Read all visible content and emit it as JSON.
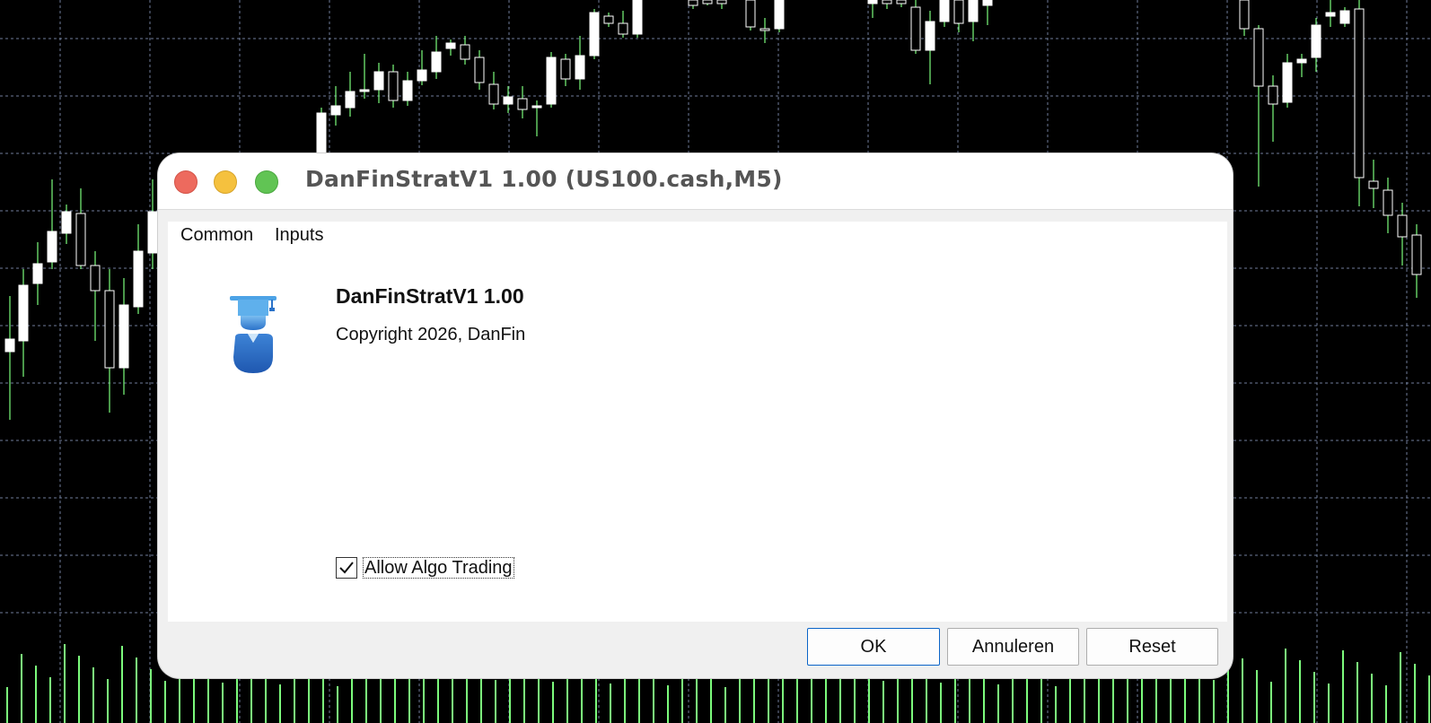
{
  "dialog": {
    "title": "DanFinStratV1 1.00 (US100.cash,M5)",
    "tabs": [
      {
        "label": "Common"
      },
      {
        "label": "Inputs"
      }
    ],
    "expert": {
      "icon": "expert-advisor-icon",
      "name": "DanFinStratV1 1.00",
      "copyright": "Copyright 2026, DanFin"
    },
    "allow_algo": {
      "label": "Allow Algo Trading",
      "checked": true
    },
    "buttons": {
      "ok": "OK",
      "cancel": "Annuleren",
      "reset": "Reset"
    }
  },
  "colors": {
    "chart_background": "#000000",
    "bull_candle": "#ffffff",
    "wick_and_volume": "#7CFC7C",
    "grid": "#6f7d9a",
    "ok_border": "#0a64c8"
  }
}
